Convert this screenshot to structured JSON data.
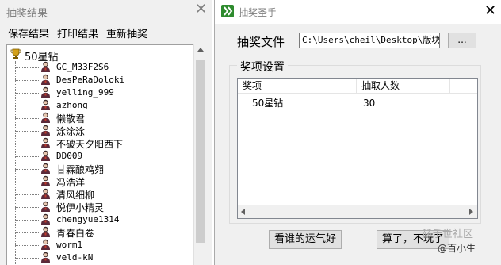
{
  "left_window": {
    "title": "抽奖结果",
    "close": "✕",
    "menu": [
      "保存结果",
      "打印结果",
      "重新抽奖"
    ],
    "tree": {
      "root_label": "50星钻",
      "root_icon": "trophy-icon",
      "item_icon": "user-avatar-icon",
      "items": [
        "GC_M33F2S6",
        "DesPeRaDoloki",
        "yelling_999",
        "azhong",
        "懒散君",
        "涂涂涂",
        "不破天夕阳西下",
        "DD009",
        "甘霖酿鸡翙",
        "冯浩洋",
        "清风细柳",
        "悦伊小精灵",
        "chengyue1314",
        "青春白卷",
        "worm1",
        "veld-kN"
      ]
    }
  },
  "right_window": {
    "title": "抽奖圣手",
    "close": "✕",
    "app_icon": "app-logo-icon",
    "file_label": "抽奖文件",
    "file_path": "C:\\Users\\cheil\\Desktop\\版块活",
    "browse_label": "...",
    "group_title": "奖项设置",
    "columns": [
      "奖项",
      "抽取人数"
    ],
    "rows": [
      {
        "prize": "50星钻",
        "count": "30"
      }
    ],
    "start_button": "看谁的运气好",
    "quit_button": "算了，不玩了"
  },
  "watermark": {
    "line1": "赫乐世社区",
    "line2": "@百小生"
  }
}
